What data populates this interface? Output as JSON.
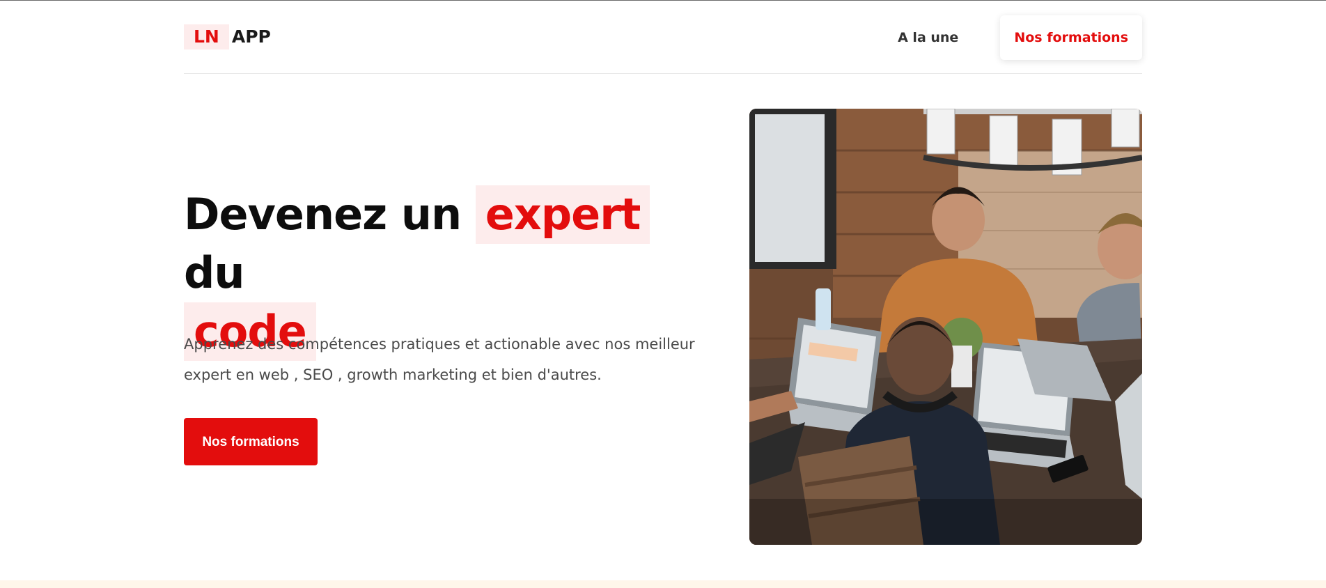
{
  "header": {
    "logo_accent": "LN",
    "logo_text": "APP",
    "nav_link": "A la une",
    "nav_button": "Nos formations"
  },
  "hero": {
    "title_part1": "Devenez un",
    "title_highlight1": "expert",
    "title_part2": "du",
    "title_highlight2": "code",
    "description": "Apprenez des compétences pratiques et actionable avec nos meilleur expert en web , SEO , growth marketing et bien d'autres.",
    "cta_label": "Nos formations"
  },
  "colors": {
    "accent": "#e30d0d",
    "highlight_bg": "#fdecec",
    "bottom_strip": "#fff6ea"
  }
}
